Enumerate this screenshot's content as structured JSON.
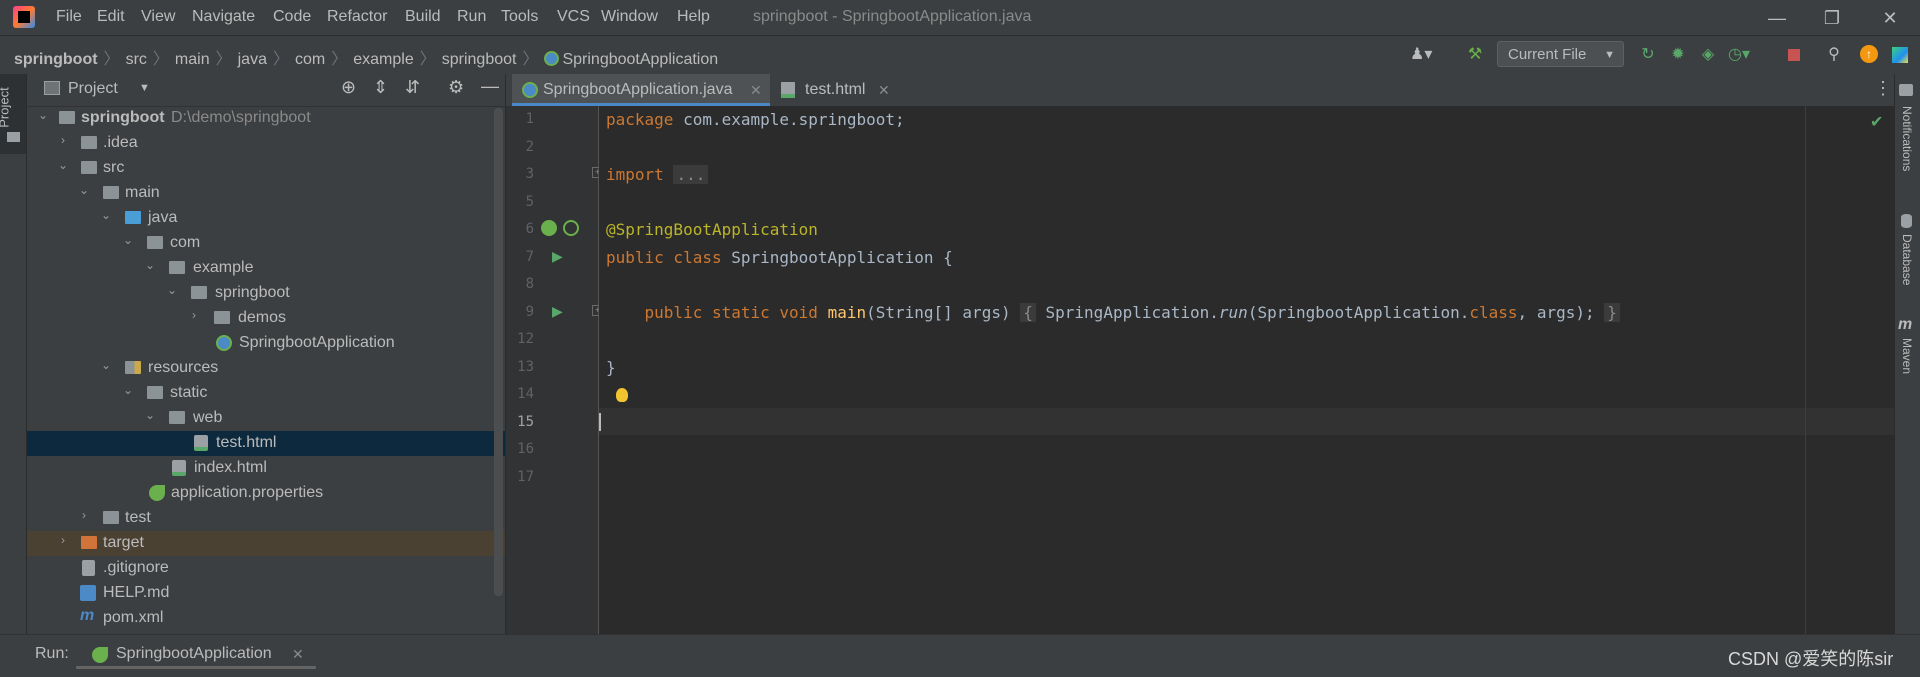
{
  "menu": [
    {
      "label": "File"
    },
    {
      "label": "Edit"
    },
    {
      "label": "View"
    },
    {
      "label": "Navigate"
    },
    {
      "label": "Code"
    },
    {
      "label": "Refactor"
    },
    {
      "label": "Build"
    },
    {
      "label": "Run"
    },
    {
      "label": "Tools"
    },
    {
      "label": "VCS"
    },
    {
      "label": "Window"
    },
    {
      "label": "Help"
    }
  ],
  "window_title": "springboot - SpringbootApplication.java",
  "breadcrumb": [
    "springboot",
    "src",
    "main",
    "java",
    "com",
    "example",
    "springboot",
    "SpringbootApplication"
  ],
  "run_config": "Current File",
  "project_panel": {
    "title": "Project",
    "tree": [
      {
        "label": "springboot",
        "path": "D:\\demo\\springboot"
      },
      {
        "label": ".idea"
      },
      {
        "label": "src"
      },
      {
        "label": "main"
      },
      {
        "label": "java"
      },
      {
        "label": "com"
      },
      {
        "label": "example"
      },
      {
        "label": "springboot"
      },
      {
        "label": "demos"
      },
      {
        "label": "SpringbootApplication"
      },
      {
        "label": "resources"
      },
      {
        "label": "static"
      },
      {
        "label": "web"
      },
      {
        "label": "test.html"
      },
      {
        "label": "index.html"
      },
      {
        "label": "application.properties"
      },
      {
        "label": "test"
      },
      {
        "label": "target"
      },
      {
        "label": ".gitignore"
      },
      {
        "label": "HELP.md"
      },
      {
        "label": "pom.xml"
      }
    ]
  },
  "left_stripe": {
    "project": "Project"
  },
  "tabs": [
    {
      "label": "SpringbootApplication.java"
    },
    {
      "label": "test.html"
    }
  ],
  "line_numbers": [
    "1",
    "2",
    "3",
    "5",
    "6",
    "7",
    "8",
    "9",
    "12",
    "13",
    "14",
    "15",
    "16",
    "17"
  ],
  "code": {
    "l1_kw": "package",
    "l1_rest": " com.example.springboot;",
    "l3_kw": "import",
    "l3_fold": "...",
    "l6": "@SpringBootApplication",
    "l7_kw": "public class",
    "l7_rest": " SpringbootApplication {",
    "l9_kw": "public static void",
    "l9_fn": "main",
    "l9_args": "(String[] args)",
    "l9_open": "{",
    "l9_call": "SpringApplication.",
    "l9_run": "run",
    "l9_p1": "(SpringbootApplication.",
    "l9_class": "class",
    "l9_p2": ", args);",
    "l9_close": "}",
    "l13": "}"
  },
  "right_stripe": [
    "Notifications",
    "Database",
    "Maven"
  ],
  "bottom": {
    "run_label": "Run:",
    "run_tab": "SpringbootApplication"
  },
  "watermark": "CSDN @爱笑的陈sir",
  "colors": {
    "accent": "#4a88c7",
    "keyword": "#cc7832",
    "annotation": "#bbb529",
    "method": "#ffc66d",
    "code": "#a9b7c6"
  }
}
